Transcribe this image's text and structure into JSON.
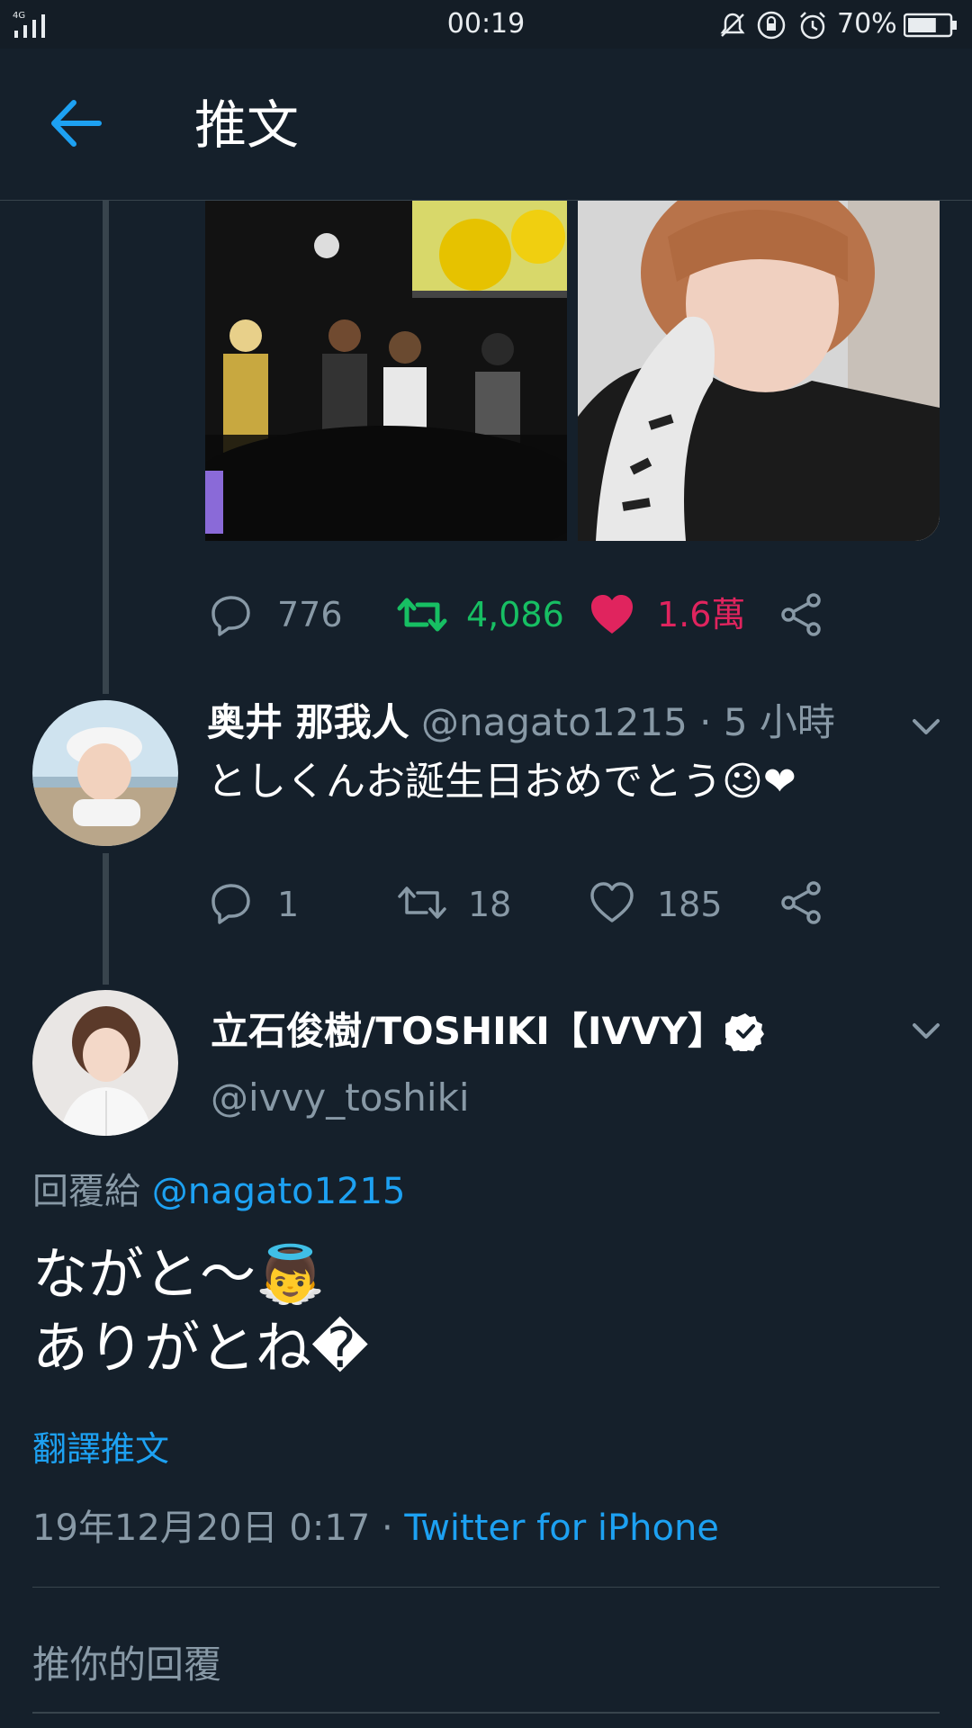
{
  "status_bar": {
    "network": "4G",
    "time": "00:19",
    "battery_percent": "70%",
    "battery_level": 0.7
  },
  "header": {
    "title": "推文"
  },
  "parent_tweet": {
    "actions": {
      "reply_count": "776",
      "retweet_count": "4,086",
      "like_count": "1.6萬"
    }
  },
  "reply_tweet": {
    "display_name": "奥井 那我人",
    "handle_time": "@nagato1215 · 5 小時",
    "text": "としくんお誕生日おめでとう😉❤",
    "actions": {
      "reply_count": "1",
      "retweet_count": "18",
      "like_count": "185"
    }
  },
  "main_tweet": {
    "display_name": "立石俊樹/TOSHIKI【IVVY】",
    "handle": "@ivvy_toshiki",
    "reply_to_prefix": "回覆給",
    "reply_to_handle": "@nagato1215",
    "text_line1": "ながと〜👼",
    "text_line2": "ありがとね�",
    "translate_link": "翻譯推文",
    "timestamp": "19年12月20日 0:17 ·",
    "source": "Twitter for iPhone"
  },
  "reply_box": {
    "placeholder": "推你的回覆"
  },
  "colors": {
    "background": "#15202b",
    "accent": "#1da1f2",
    "retweet_green": "#17bf63",
    "like_pink": "#e0245e",
    "muted": "#8899a6",
    "divider": "#38444d"
  }
}
